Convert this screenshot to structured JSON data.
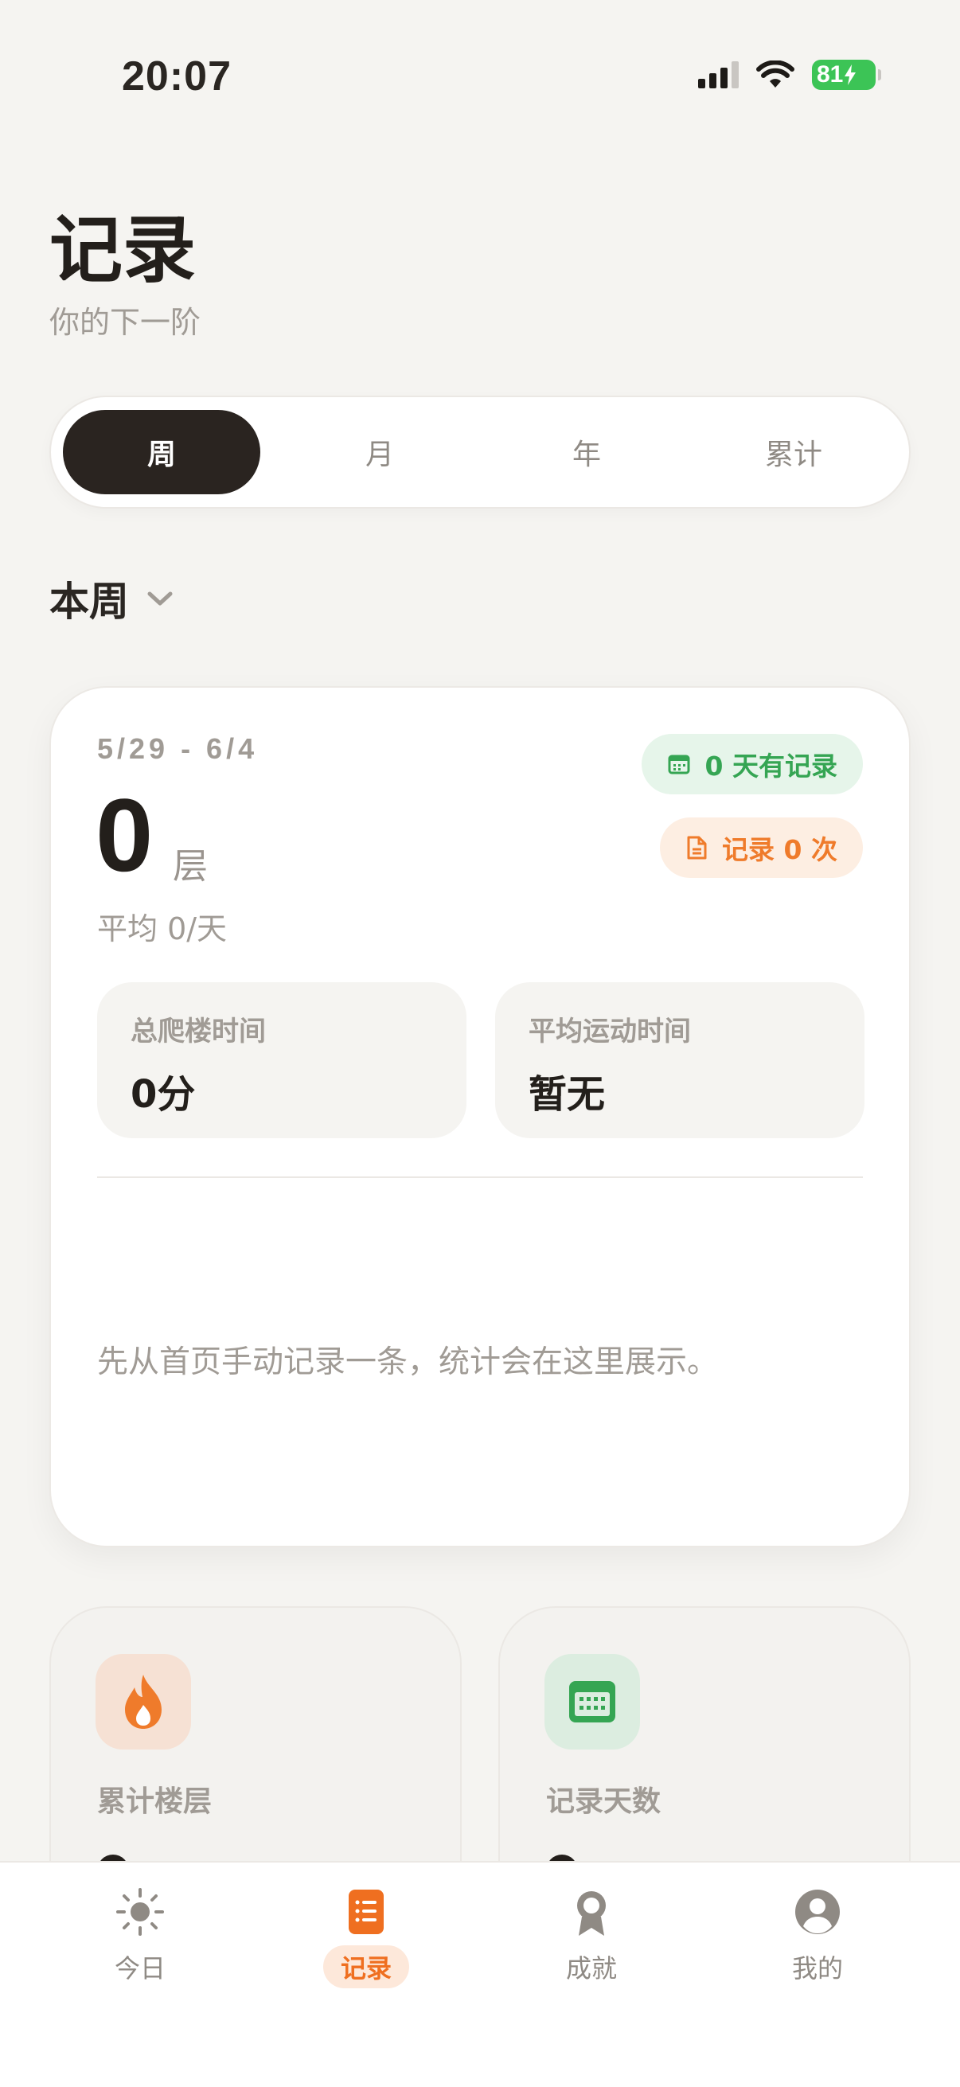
{
  "status_bar": {
    "time": "20:07",
    "battery": "81"
  },
  "header": {
    "title": "记录",
    "subtitle": "你的下一阶"
  },
  "segmented": {
    "tabs": [
      "周",
      "月",
      "年",
      "累计"
    ],
    "selected": 0
  },
  "period": {
    "label": "本周"
  },
  "summary": {
    "date_range": "5/29 - 6/4",
    "total_floors": "0",
    "unit": "层",
    "average": "平均 0/天",
    "days_badge": "0 天有记录",
    "count_badge": "记录 0 次",
    "total_time_label": "总爬楼时间",
    "total_time_value": "0分",
    "avg_time_label": "平均运动时间",
    "avg_time_value": "暂无",
    "empty_message": "先从首页手动记录一条，统计会在这里展示。"
  },
  "mini_cards": [
    {
      "label": "累计楼层",
      "icon": "flame-icon",
      "color": "#ef7b2b"
    },
    {
      "label": "记录天数",
      "icon": "calendar-icon",
      "color": "#35a553"
    }
  ],
  "tab_bar": {
    "items": [
      {
        "label": "今日",
        "icon": "sun-icon"
      },
      {
        "label": "记录",
        "icon": "list-icon"
      },
      {
        "label": "成就",
        "icon": "award-icon"
      },
      {
        "label": "我的",
        "icon": "profile-icon"
      }
    ],
    "active": 1
  },
  "colors": {
    "accent": "#ef6f20",
    "green": "#35a553",
    "dark": "#2a2420",
    "background": "#f5f4f1"
  }
}
